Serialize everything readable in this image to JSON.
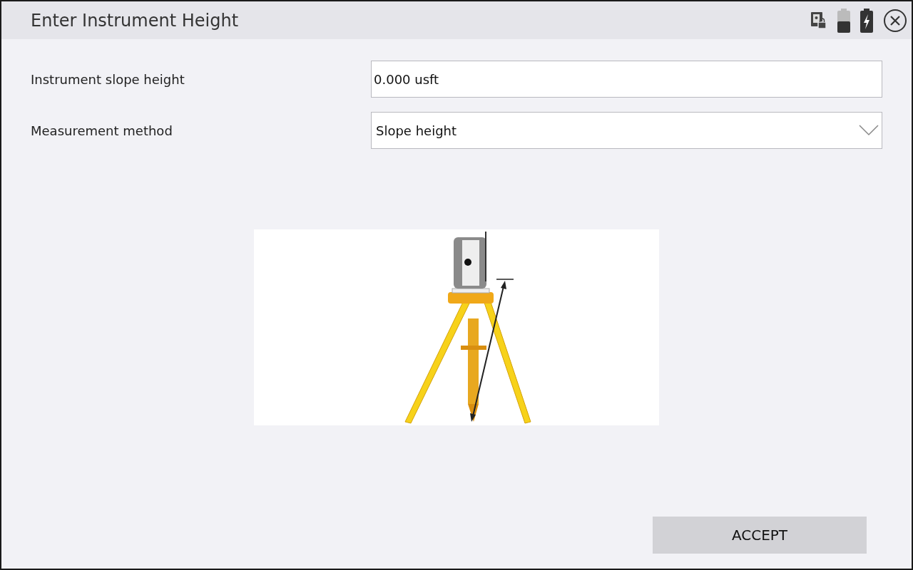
{
  "window": {
    "title": "Enter Instrument Height"
  },
  "fields": [
    {
      "kind": "input",
      "label": "Instrument slope height",
      "value": "0.000 usft"
    },
    {
      "kind": "dropdown",
      "label": "Measurement method",
      "value": "Slope height"
    }
  ],
  "buttons": [
    "ACCEPT"
  ]
}
